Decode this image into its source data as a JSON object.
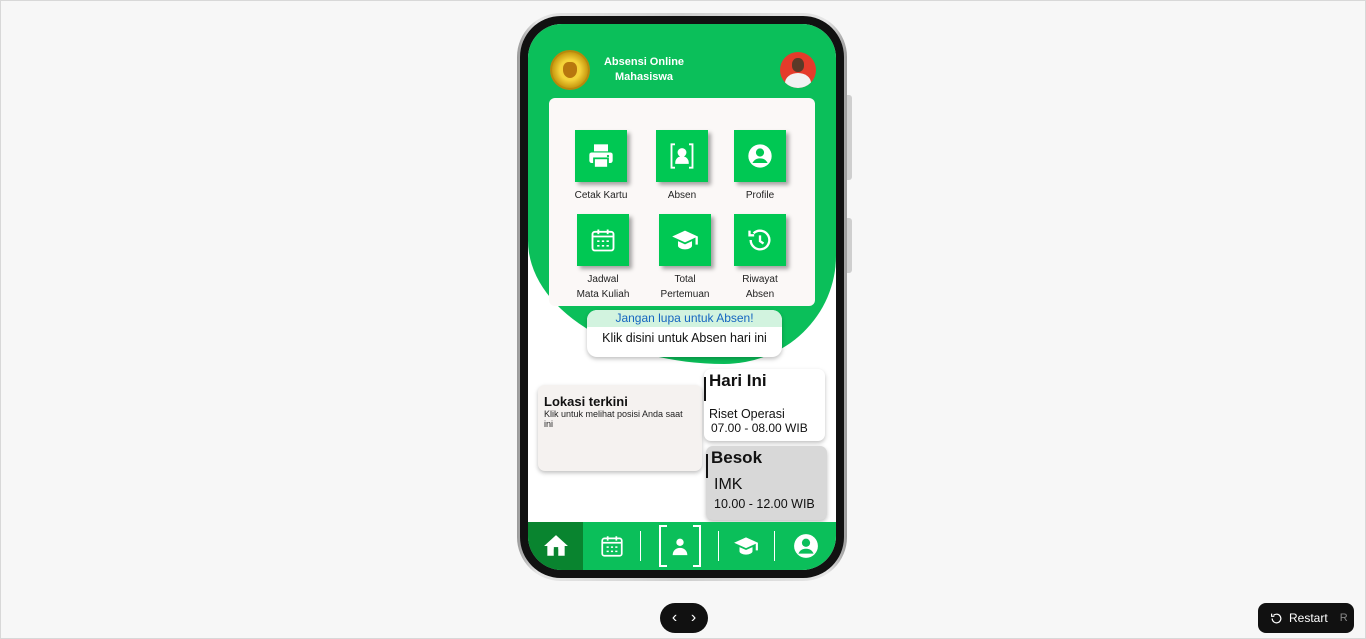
{
  "app": {
    "title_line1": "Absensi Online",
    "title_line2": "Mahasiswa"
  },
  "menu": {
    "items": [
      {
        "label": "Cetak Kartu",
        "icon": "printer-icon"
      },
      {
        "label": "Absen",
        "icon": "person-frame-icon"
      },
      {
        "label": "Profile",
        "icon": "profile-icon"
      },
      {
        "label_line1": "Jadwal",
        "label_line2": "Mata Kuliah",
        "icon": "calendar-icon"
      },
      {
        "label_line1": "Total",
        "label_line2": "Pertemuan",
        "icon": "graduation-cap-icon"
      },
      {
        "label_line1": "Riwayat",
        "label_line2": "Absen",
        "icon": "history-icon"
      }
    ]
  },
  "reminder": {
    "title": "Jangan lupa untuk Absen!",
    "body": "Klik disini untuk Absen hari ini"
  },
  "location": {
    "title": "Lokasi terkini",
    "description": "Klik untuk melihat posisi Anda saat ini"
  },
  "schedule": {
    "today": {
      "heading": "Hari Ini",
      "course": "Riset Operasi",
      "time": "07.00 - 08.00 WIB"
    },
    "tomorrow": {
      "heading": "Besok",
      "course": "IMK",
      "time": "10.00 - 12.00 WIB"
    }
  },
  "bottom_nav": [
    "home-icon",
    "calendar-icon",
    "person-frame-icon",
    "graduation-cap-icon",
    "profile-icon"
  ],
  "controls": {
    "prev": "‹",
    "next": "›",
    "restart_label": "Restart",
    "restart_key": "R"
  },
  "colors": {
    "primary_green": "#0bbf5a",
    "tile_green": "#00c853",
    "active_nav": "#09842f"
  }
}
